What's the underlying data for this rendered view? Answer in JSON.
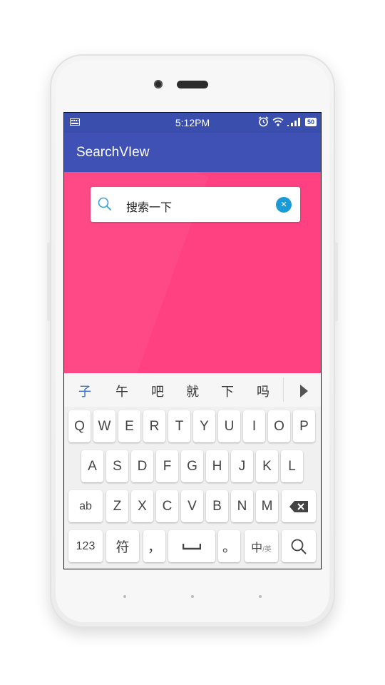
{
  "status_bar": {
    "time": "5:12PM",
    "battery": "50"
  },
  "app_bar": {
    "title": "SearchVIew"
  },
  "search": {
    "query": "搜索一下"
  },
  "candidates": [
    "子",
    "午",
    "吧",
    "就",
    "下",
    "吗"
  ],
  "keyboard": {
    "row1": [
      "Q",
      "W",
      "E",
      "R",
      "T",
      "Y",
      "U",
      "I",
      "O",
      "P"
    ],
    "row2": [
      "A",
      "S",
      "D",
      "F",
      "G",
      "H",
      "J",
      "K",
      "L"
    ],
    "row3": [
      "Z",
      "X",
      "C",
      "V",
      "B",
      "N",
      "M"
    ],
    "shift_label": "ab",
    "num_label": "123",
    "symbol_label": "符",
    "comma_label": "，",
    "period_label": "。",
    "lang_label": "中",
    "lang_sub_label": "/英"
  },
  "colors": {
    "primary": "#3f51b5",
    "status_bar": "#3a4ead",
    "accent": "#ff4081",
    "clear_button": "#1a9ad6"
  }
}
